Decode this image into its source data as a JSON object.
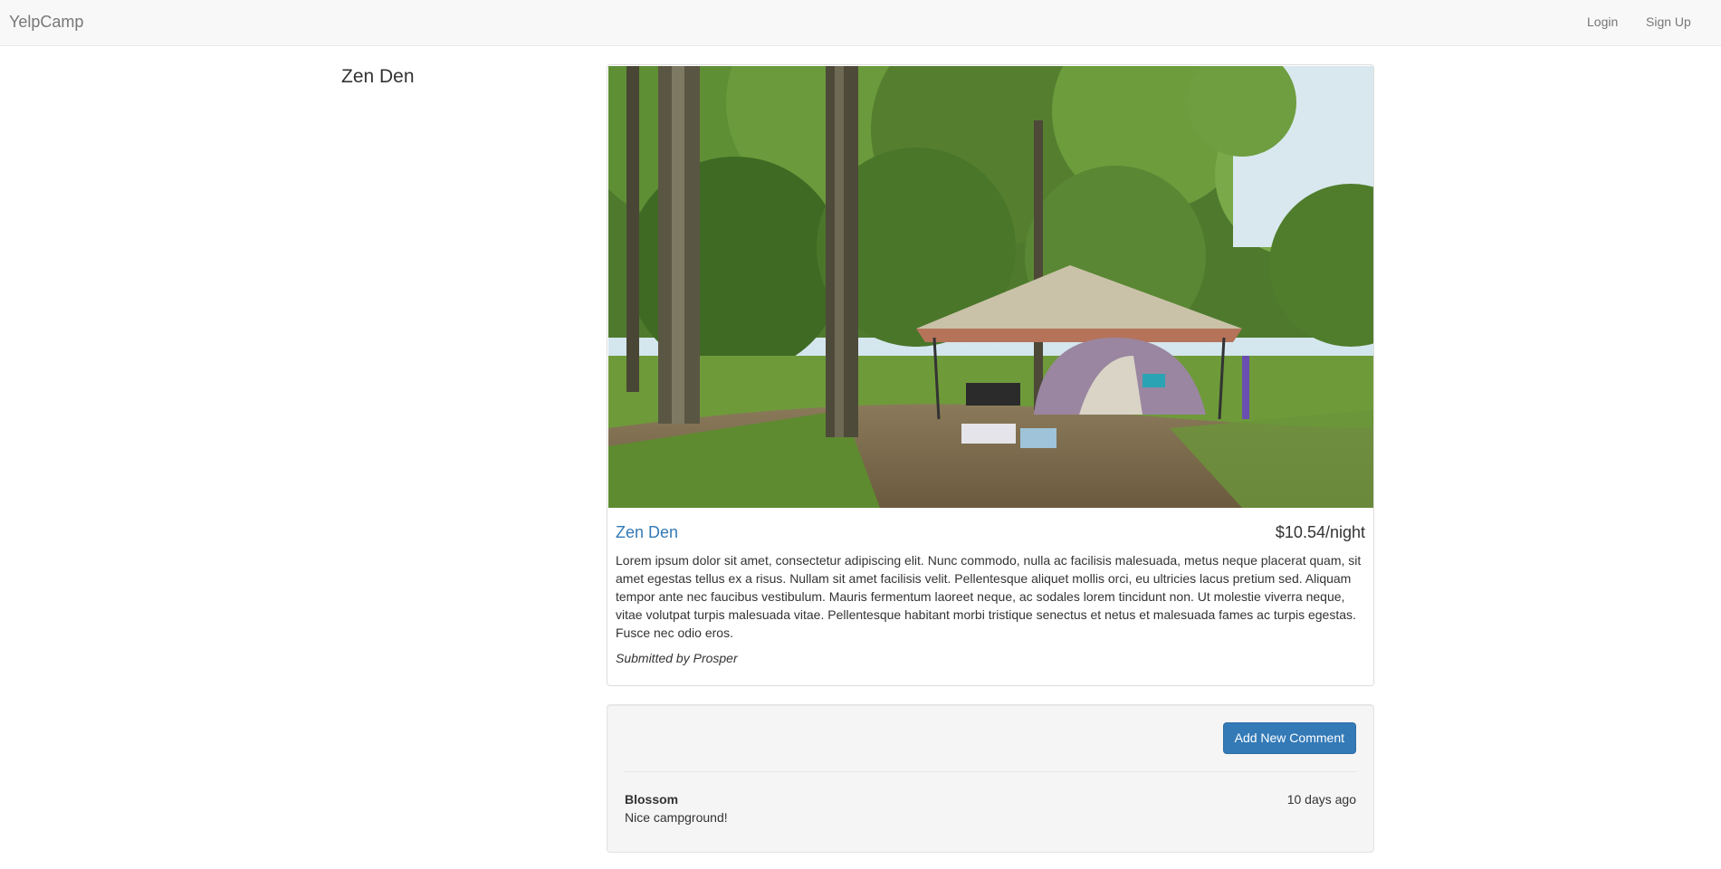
{
  "navbar": {
    "brand": "YelpCamp",
    "links": {
      "login": "Login",
      "signup": "Sign Up"
    }
  },
  "sidebar": {
    "title": "Zen Den"
  },
  "campground": {
    "name": "Zen Den",
    "price": "$10.54/night",
    "description": "Lorem ipsum dolor sit amet, consectetur adipiscing elit. Nunc commodo, nulla ac facilisis malesuada, metus neque placerat quam, sit amet egestas tellus ex a risus. Nullam sit amet facilisis velit. Pellentesque aliquet mollis orci, eu ultricies lacus pretium sed. Aliquam tempor ante nec faucibus vestibulum. Mauris fermentum laoreet neque, ac sodales lorem tincidunt non. Ut molestie viverra neque, vitae volutpat turpis malesuada vitae. Pellentesque habitant morbi tristique senectus et netus et malesuada fames ac turpis egestas. Fusce nec odio eros.",
    "submitted_by": "Submitted by Prosper",
    "image": "campsite-photo"
  },
  "comments": {
    "add_button": "Add New Comment",
    "items": [
      {
        "author": "Blossom",
        "time": "10 days ago",
        "text": "Nice campground!"
      }
    ]
  },
  "colors": {
    "navbar_bg": "#f8f8f8",
    "link": "#337ab7",
    "primary_button": "#337ab7",
    "well_bg": "#f5f5f5"
  }
}
